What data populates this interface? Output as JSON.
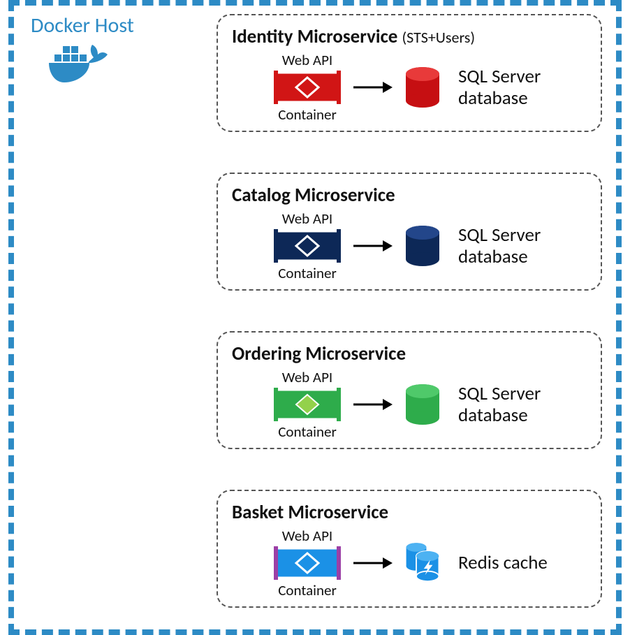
{
  "host": {
    "title": "Docker Host",
    "border_color": "#2d8bc5",
    "logo_color": "#2d8bc5"
  },
  "microservices": [
    {
      "id": "identity",
      "title": "Identity Microservice",
      "subtitle": "(STS+Users)",
      "container_label_top": "Web API",
      "container_label_bottom": "Container",
      "container_main_color": "#d11515",
      "container_accent_color": "#d11515",
      "storage_label": "SQL Server database",
      "storage_type": "cylinder",
      "storage_color": "#c60f12"
    },
    {
      "id": "catalog",
      "title": "Catalog Microservice",
      "subtitle": "",
      "container_label_top": "Web API",
      "container_label_bottom": "Container",
      "container_main_color": "#0d2857",
      "container_accent_color": "#0d2857",
      "storage_label": "SQL Server database",
      "storage_type": "cylinder",
      "storage_color": "#0d2857"
    },
    {
      "id": "ordering",
      "title": "Ordering Microservice",
      "subtitle": "",
      "container_label_top": "Web API",
      "container_label_bottom": "Container",
      "container_main_color": "#2eac4b",
      "container_accent_color": "#93d14b",
      "storage_label": "SQL Server database",
      "storage_type": "cylinder",
      "storage_color": "#2eac4b"
    },
    {
      "id": "basket",
      "title": "Basket Microservice",
      "subtitle": "",
      "container_label_top": "Web API",
      "container_label_bottom": "Container",
      "container_main_color": "#1b91e6",
      "container_accent_color": "#9c3fa6",
      "storage_label": "Redis cache",
      "storage_type": "redis",
      "storage_color": "#1b91e6"
    }
  ]
}
